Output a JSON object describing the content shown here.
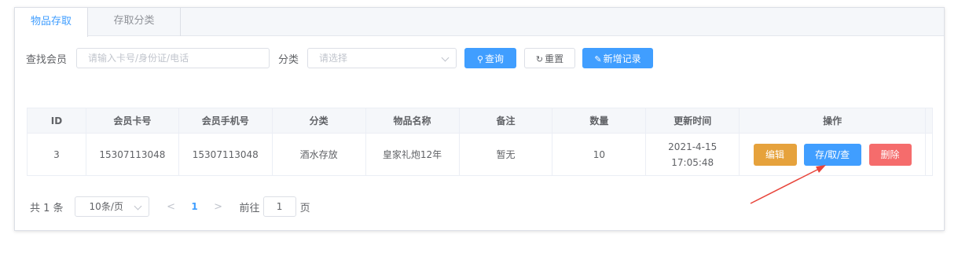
{
  "tabs": [
    {
      "label": "物品存取",
      "active": true
    },
    {
      "label": "存取分类",
      "active": false
    }
  ],
  "search": {
    "member_label": "查找会员",
    "member_placeholder": "请输入卡号/身份证/电话",
    "category_label": "分类",
    "category_placeholder": "请选择",
    "query_label": "查询",
    "reset_label": "重置",
    "add_label": "新增记录"
  },
  "table": {
    "headers": [
      "ID",
      "会员卡号",
      "会员手机号",
      "分类",
      "物品名称",
      "备注",
      "数量",
      "更新时间",
      "操作"
    ],
    "rows": [
      {
        "id": "3",
        "card_no": "15307113048",
        "phone": "15307113048",
        "category": "酒水存放",
        "item_name": "皇家礼炮12年",
        "remark": "暂无",
        "quantity": "10",
        "updated_date": "2021-4-15",
        "updated_time": "17:05:48",
        "actions": {
          "edit": "编辑",
          "store": "存/取/查",
          "delete": "删除"
        }
      }
    ]
  },
  "pagination": {
    "total": "共 1 条",
    "page_size": "10条/页",
    "prev": "<",
    "current_page": "1",
    "next": ">",
    "goto_label": "前往",
    "goto_value": "1",
    "page_suffix": "页"
  },
  "colors": {
    "primary": "#409eff",
    "warning": "#e6a23c",
    "danger": "#f56c6c",
    "annotation_arrow": "#e8443a"
  }
}
